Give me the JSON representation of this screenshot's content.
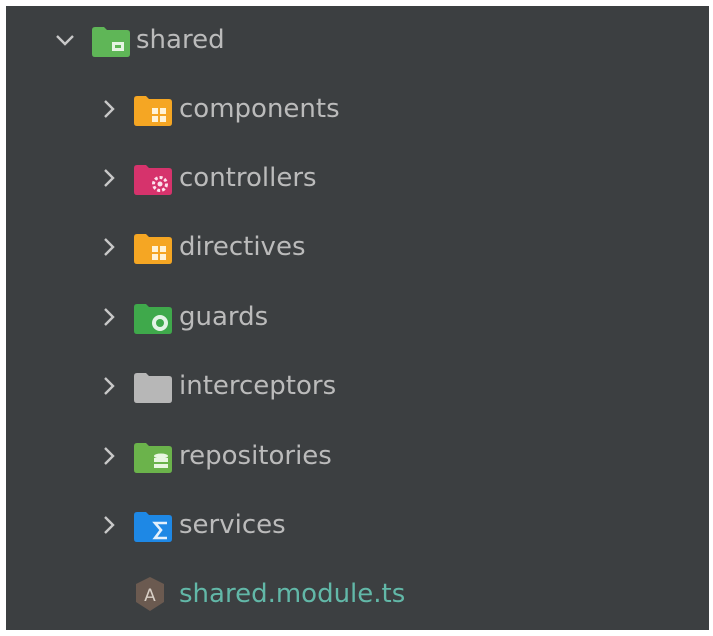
{
  "tree": {
    "root": {
      "label": "shared",
      "expanded": true,
      "icon": "module-folder-icon",
      "color": "#5fb657"
    },
    "items": [
      {
        "label": "components",
        "icon": "components-folder-icon",
        "color": "#f5a623"
      },
      {
        "label": "controllers",
        "icon": "controllers-folder-icon",
        "color": "#d6336c"
      },
      {
        "label": "directives",
        "icon": "directives-folder-icon",
        "color": "#f5a623"
      },
      {
        "label": "guards",
        "icon": "guards-folder-icon",
        "color": "#3fa94b"
      },
      {
        "label": "interceptors",
        "icon": "folder-icon",
        "color": "#b7b7b7"
      },
      {
        "label": "repositories",
        "icon": "repositories-folder-icon",
        "color": "#6bb34b"
      },
      {
        "label": "services",
        "icon": "services-folder-icon",
        "color": "#1e88e5"
      }
    ],
    "file": {
      "label": "shared.module.ts",
      "icon": "angular-icon",
      "color": "#62b8a8"
    }
  }
}
